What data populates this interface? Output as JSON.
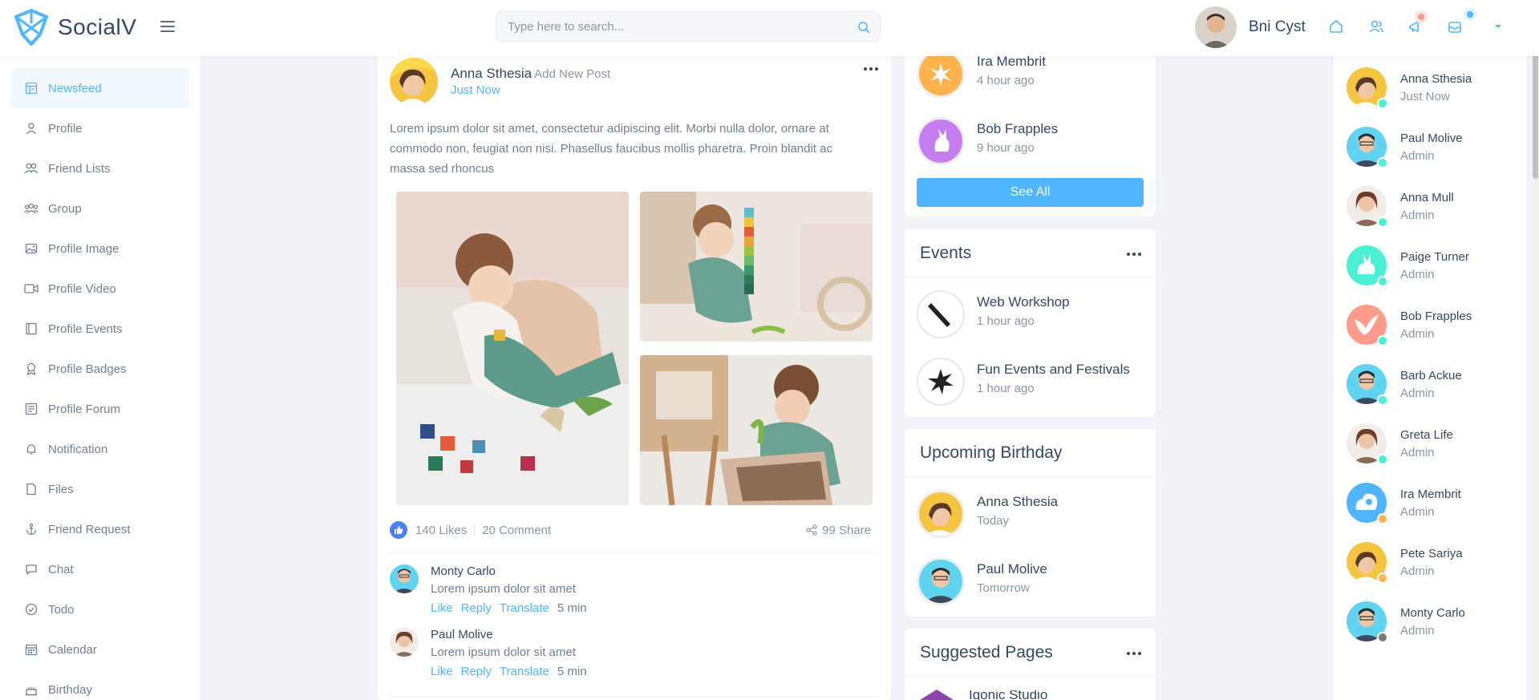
{
  "header": {
    "app_name": "SocialV",
    "search_placeholder": "Type here to search...",
    "user_name": "Bni Cyst",
    "accent": "#50b5ff",
    "icons": [
      "home-icon",
      "friends-icon",
      "notification-icon",
      "mail-icon",
      "caret-down-icon"
    ]
  },
  "sidebar": {
    "items": [
      {
        "label": "Newsfeed",
        "icon": "newsfeed-icon",
        "active": true
      },
      {
        "label": "Profile",
        "icon": "user-icon"
      },
      {
        "label": "Friend Lists",
        "icon": "users-icon"
      },
      {
        "label": "Group",
        "icon": "group-icon"
      },
      {
        "label": "Profile Image",
        "icon": "image-icon"
      },
      {
        "label": "Profile Video",
        "icon": "video-icon"
      },
      {
        "label": "Profile Events",
        "icon": "calendar-page-icon"
      },
      {
        "label": "Profile Badges",
        "icon": "badge-icon"
      },
      {
        "label": "Profile Forum",
        "icon": "forum-icon"
      },
      {
        "label": "Notification",
        "icon": "bell-icon"
      },
      {
        "label": "Files",
        "icon": "file-icon"
      },
      {
        "label": "Friend Request",
        "icon": "anchor-icon"
      },
      {
        "label": "Chat",
        "icon": "chat-icon"
      },
      {
        "label": "Todo",
        "icon": "check-circle-icon"
      },
      {
        "label": "Calendar",
        "icon": "calendar-icon"
      },
      {
        "label": "Birthday",
        "icon": "cake-icon"
      }
    ]
  },
  "post": {
    "author": "Anna Sthesia",
    "action": "Add New Post",
    "time": "Just Now",
    "text": "Lorem ipsum dolor sit amet, consectetur adipiscing elit. Morbi nulla dolor, ornare at commodo non, feugiat non nisi. Phasellus faucibus mollis pharetra. Proin blandit ac massa sed rhoncus",
    "likes": "140 Likes",
    "comments": "20 Comment",
    "shares": "99 Share",
    "comment_list": [
      {
        "name": "Monty Carlo",
        "text": "Lorem ipsum dolor sit amet",
        "like": "Like",
        "reply": "Reply",
        "translate": "Translate",
        "time": "5 min"
      },
      {
        "name": "Paul Molive",
        "text": "Lorem ipsum dolor sit amet",
        "like": "Like",
        "reply": "Reply",
        "translate": "Translate",
        "time": "5 min"
      }
    ]
  },
  "activity": {
    "items": [
      {
        "name": "Ira Membrit",
        "sub": "4 hour ago"
      },
      {
        "name": "Bob Frapples",
        "sub": "9 hour ago"
      }
    ],
    "see_all": "See All"
  },
  "events": {
    "title": "Events",
    "items": [
      {
        "name": "Web Workshop",
        "sub": "1 hour ago"
      },
      {
        "name": "Fun Events and Festivals",
        "sub": "1 hour ago"
      }
    ]
  },
  "birthdays": {
    "title": "Upcoming Birthday",
    "items": [
      {
        "name": "Anna Sthesia",
        "sub": "Today"
      },
      {
        "name": "Paul Molive",
        "sub": "Tomorrow"
      }
    ]
  },
  "suggested": {
    "title": "Suggested Pages",
    "first": "Iqonic Studio"
  },
  "chat": {
    "users": [
      {
        "name": "Anna Sthesia",
        "sub": "Just Now",
        "status": "online"
      },
      {
        "name": "Paul Molive",
        "sub": "Admin",
        "status": "online"
      },
      {
        "name": "Anna Mull",
        "sub": "Admin",
        "status": "online"
      },
      {
        "name": "Paige Turner",
        "sub": "Admin",
        "status": "online"
      },
      {
        "name": "Bob Frapples",
        "sub": "Admin",
        "status": "online"
      },
      {
        "name": "Barb Ackue",
        "sub": "Admin",
        "status": "online"
      },
      {
        "name": "Greta Life",
        "sub": "Admin",
        "status": "online"
      },
      {
        "name": "Ira Membrit",
        "sub": "Admin",
        "status": "away"
      },
      {
        "name": "Pete Sariya",
        "sub": "Admin",
        "status": "away"
      },
      {
        "name": "Monty Carlo",
        "sub": "Admin",
        "status": "offline"
      }
    ],
    "status_colors": {
      "online": "#49f0d3",
      "away": "#fbb550",
      "offline": "#777d74"
    }
  }
}
